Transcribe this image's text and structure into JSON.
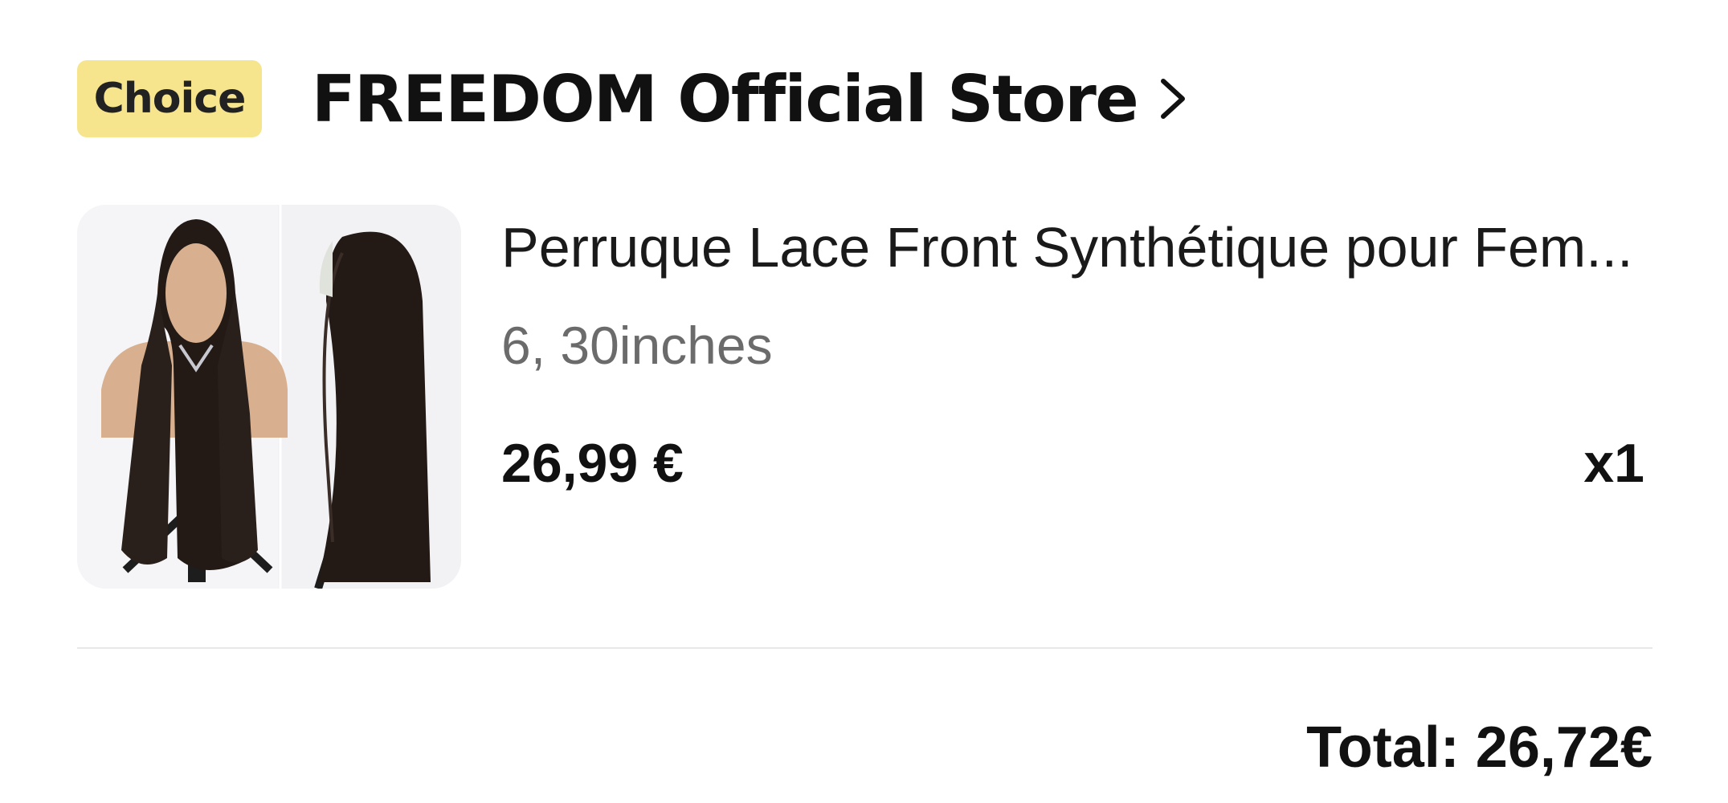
{
  "store": {
    "badge": "Choice",
    "name": "FREEDOM Official Store",
    "chevron_icon": "chevron-right-icon",
    "badge_color": "#f6e58d"
  },
  "product": {
    "title": "Perruque Lace Front Synthétique pour Fem...",
    "variant": "6, 30inches",
    "price": "26,99 €",
    "quantity": "x1",
    "image_icon": "wig-product-image"
  },
  "summary": {
    "total": "Total: 26,72€"
  }
}
